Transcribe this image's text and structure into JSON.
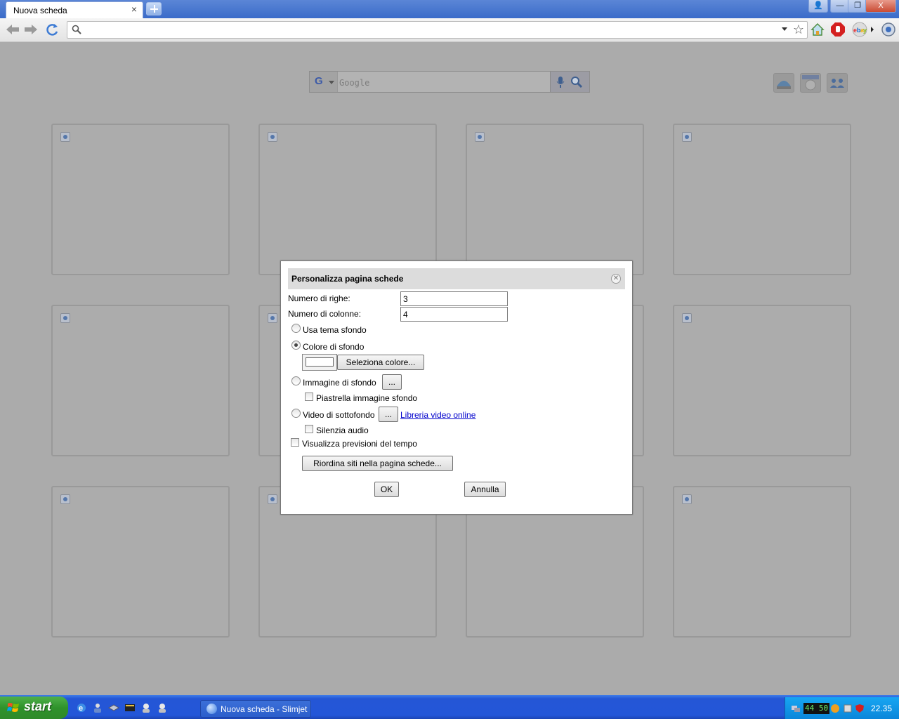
{
  "browser": {
    "tab_title": "Nuova scheda",
    "tab_close": "×",
    "window_buttons": {
      "profile": "👤",
      "minimize": "—",
      "restore": "❐",
      "close": "X"
    },
    "omnibox_value": "",
    "icons": [
      "back-icon",
      "forward-icon",
      "reload-icon",
      "search-icon",
      "star-icon",
      "home-icon",
      "adblock-icon",
      "ebay-icon",
      "settings-icon"
    ]
  },
  "page": {
    "search_placeholder": "Google",
    "search_logo": "G",
    "tile_count": 12
  },
  "dialog": {
    "title": "Personalizza pagina schede",
    "rows_label": "Numero di righe:",
    "rows_value": "3",
    "cols_label": "Numero di colonne:",
    "cols_value": "4",
    "radio_theme": "Usa tema sfondo",
    "radio_color": "Colore di sfondo",
    "select_color_button": "Seleziona colore...",
    "radio_image": "Immagine di sfondo",
    "browse_button": "...",
    "tile_image": "Piastrella immagine sfondo",
    "radio_video": "Video di sottofondo",
    "video_library_link": "Libreria video online",
    "mute_audio": "Silenzia audio",
    "weather": "Visualizza previsioni del tempo",
    "reorder_button": "Riordina siti nella pagina schede...",
    "ok_button": "OK",
    "cancel_button": "Annulla",
    "selected_background": "Colore di sfondo"
  },
  "taskbar": {
    "start_label": "start",
    "task_label": "Nuova scheda - Slimjet",
    "tray_counter": "44 50",
    "clock": "22.35"
  }
}
